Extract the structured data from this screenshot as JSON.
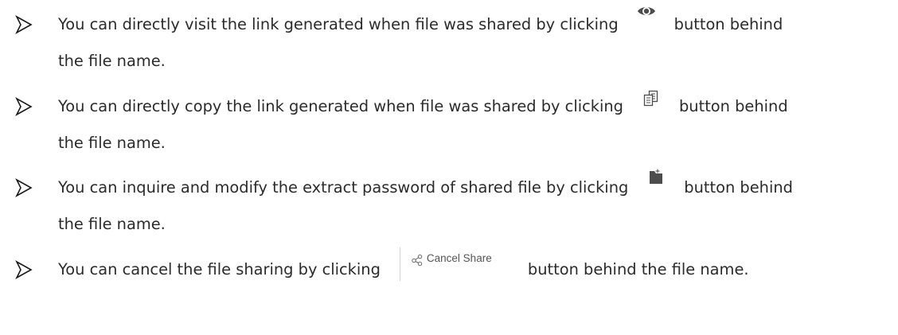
{
  "items": [
    {
      "text_before": "You can directly visit the link generated when file was shared by clicking",
      "icon": "eye-icon",
      "text_after": "button behind",
      "text_line2": "the file name."
    },
    {
      "text_before": "You can directly copy the link generated when file was shared by clicking",
      "icon": "copy-icon",
      "text_after": "button behind",
      "text_line2": "the file name."
    },
    {
      "text_before": "You can inquire and modify the extract password of shared file by clicking",
      "icon": "folder-plus-icon",
      "text_after": "button behind",
      "text_line2": "the file name."
    },
    {
      "text_before": "You can cancel the file sharing by clicking",
      "icon": "share-icon",
      "button_label": "Cancel Share",
      "text_after": "button behind the file name."
    }
  ]
}
